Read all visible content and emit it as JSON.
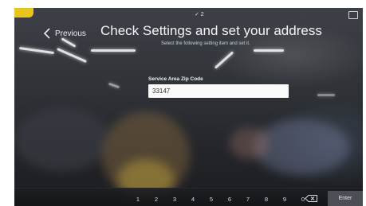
{
  "header": {
    "previous_label": "Previous",
    "title": "Check Settings and set your address",
    "subtitle": "Select the following setting item and set it."
  },
  "status": {
    "indicator_text": "✓ 2"
  },
  "form": {
    "zip_label": "Service Area Zip Code",
    "zip_value": "33147"
  },
  "keyboard": {
    "keys": [
      "1",
      "2",
      "3",
      "4",
      "5",
      "6",
      "7",
      "8",
      "9",
      "0"
    ],
    "enter_label": "Enter",
    "backspace_icon": "backspace-icon"
  },
  "colors": {
    "accent_sticker": "#e8c51c",
    "screen_bg": "#2f3338"
  }
}
